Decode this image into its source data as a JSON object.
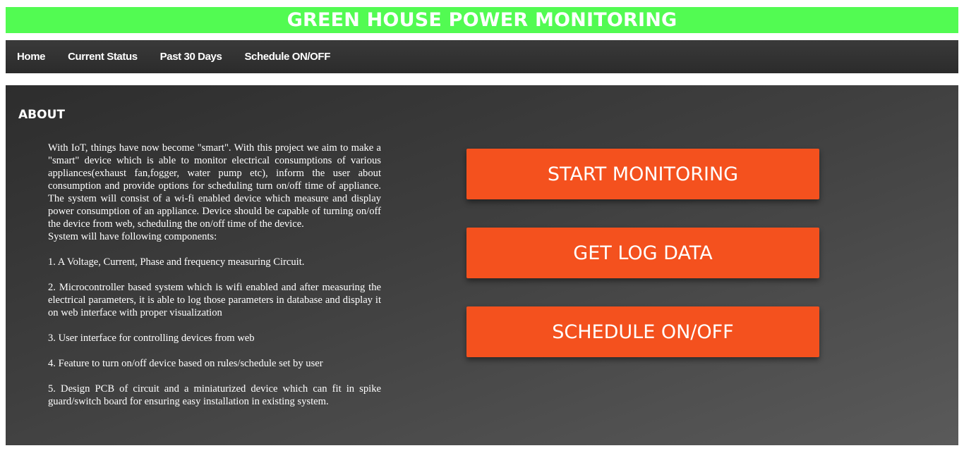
{
  "header": {
    "title": "GREEN HOUSE POWER MONITORING"
  },
  "nav": {
    "items": [
      {
        "label": "Home"
      },
      {
        "label": "Current Status"
      },
      {
        "label": "Past 30 Days"
      },
      {
        "label": "Schedule ON/OFF"
      }
    ]
  },
  "about": {
    "heading": "ABOUT",
    "intro": "With IoT, things have now become \"smart\". With this project we aim to make a \"smart\" device which is able to monitor electrical consumptions of various appliances(exhaust fan,fogger, water pump etc), inform the user about consumption and provide options for scheduling turn on/off time of appliance. The system will consist of a wi-fi enabled device which measure and display power consumption of an appliance. Device should be capable of turning on/off the device from web, scheduling the on/off time of the device.",
    "components_intro": "System will have following components:",
    "components": [
      "1. A Voltage, Current, Phase and frequency measuring Circuit.",
      "2. Microcontroller based system which is wifi enabled and after measuring the electrical parameters, it is able to log those parameters in database and display it on web interface with proper visualization",
      "3. User interface for controlling devices from web",
      "4. Feature to turn on/off device based on rules/schedule set by user",
      "5. Design PCB of circuit and a miniaturized device which can fit in spike guard/switch board for ensuring easy installation in existing system."
    ]
  },
  "actions": {
    "start_monitoring": "START MONITORING",
    "get_log_data": "GET LOG DATA",
    "schedule": "SCHEDULE ON/OFF"
  },
  "colors": {
    "banner": "#52fb52",
    "button": "#f4511e",
    "navbar": "#333333"
  }
}
